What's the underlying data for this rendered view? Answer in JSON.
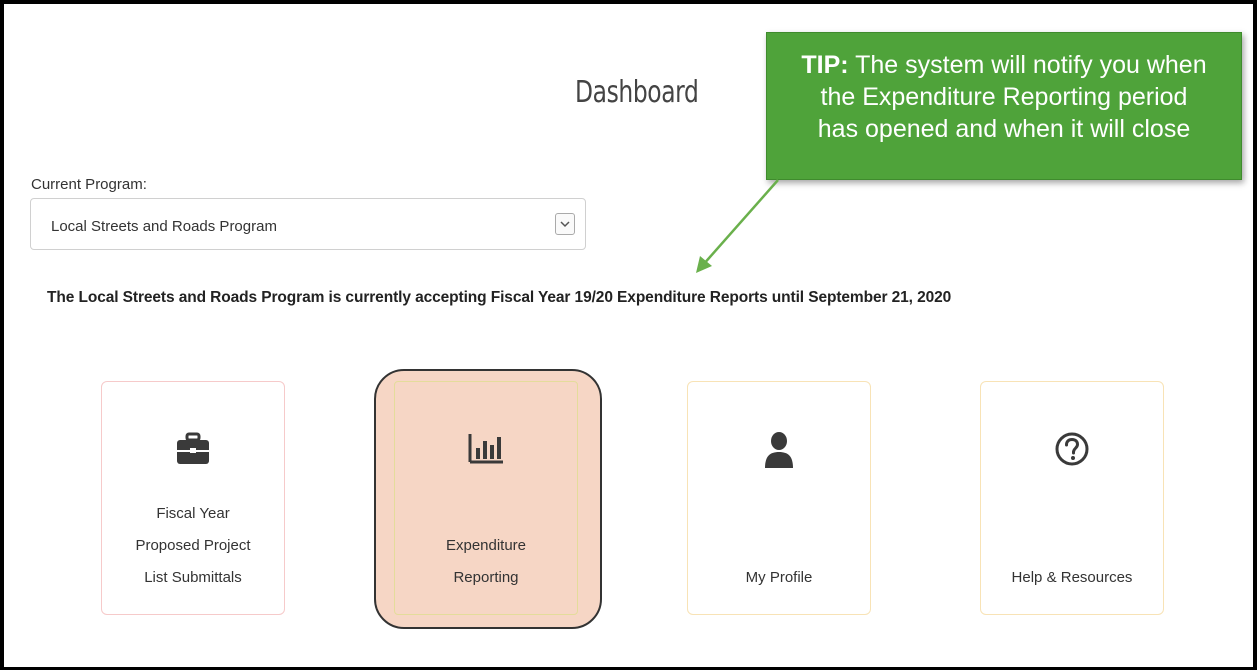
{
  "page": {
    "title": "Dashboard"
  },
  "tip": {
    "prefix": "TIP:",
    "line1": "The system will notify you when",
    "line2": "the Expenditure Reporting period",
    "line3": "has opened and when it will close"
  },
  "program": {
    "label": "Current Program:",
    "selected": "Local Streets and Roads Program"
  },
  "notice": "The Local Streets and Roads Program is currently accepting Fiscal Year 19/20 Expenditure Reports until September 21, 2020",
  "cards": [
    {
      "icon": "briefcase-icon",
      "lines": [
        "Fiscal Year",
        "Proposed Project",
        "List Submittals"
      ]
    },
    {
      "icon": "bar-chart-icon",
      "lines": [
        "Expenditure",
        "Reporting"
      ]
    },
    {
      "icon": "user-icon",
      "lines": [
        "My Profile"
      ]
    },
    {
      "icon": "question-circle-icon",
      "lines": [
        "Help & Resources"
      ]
    }
  ],
  "colors": {
    "tip_bg": "#4fa33a",
    "highlight": "#f6d6c5",
    "arrow": "#6ab04c"
  }
}
